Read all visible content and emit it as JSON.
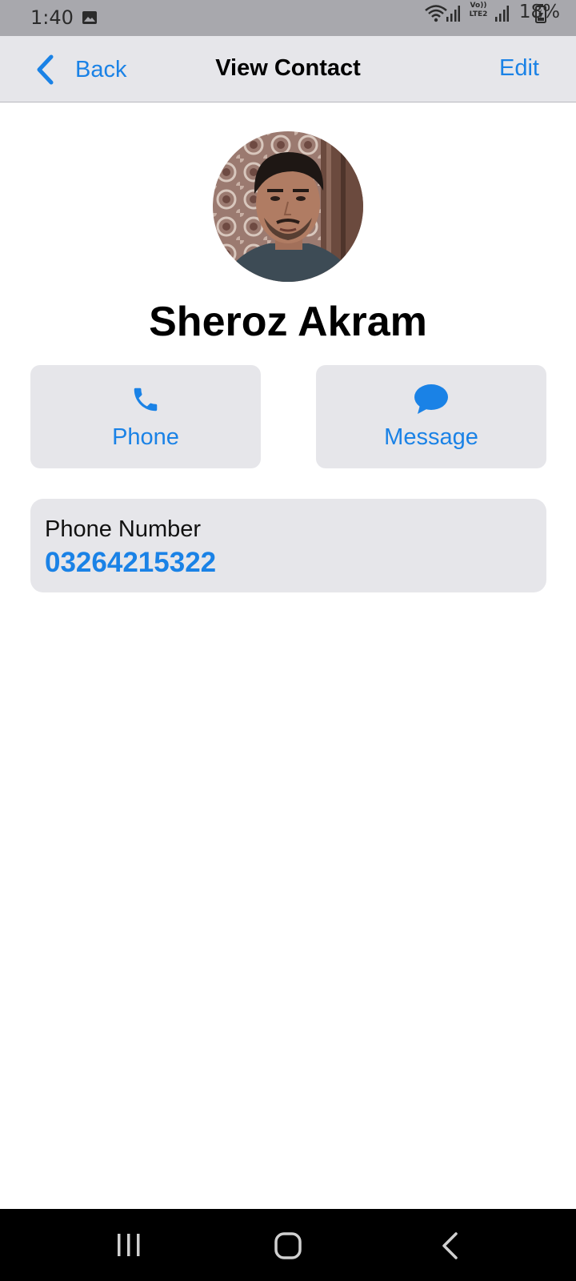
{
  "status_bar": {
    "time": "1:40",
    "battery": "18%",
    "volte_top": "Vo))",
    "volte_bottom": "LTE2",
    "icons": [
      "gallery-icon",
      "wifi-icon",
      "signal-icon",
      "volte-icon",
      "signal-icon",
      "battery-icon"
    ]
  },
  "nav": {
    "back_label": "Back",
    "title": "View Contact",
    "edit_label": "Edit",
    "accent": "#1a82e6"
  },
  "contact": {
    "name": "Sheroz Akram",
    "avatar_icon": "avatar-photo"
  },
  "actions": {
    "phone_label": "Phone",
    "message_label": "Message"
  },
  "details": {
    "phone_label": "Phone Number",
    "phone_value": "03264215322"
  },
  "system_nav": {
    "icons": [
      "recent-apps-icon",
      "home-icon",
      "back-icon"
    ]
  }
}
